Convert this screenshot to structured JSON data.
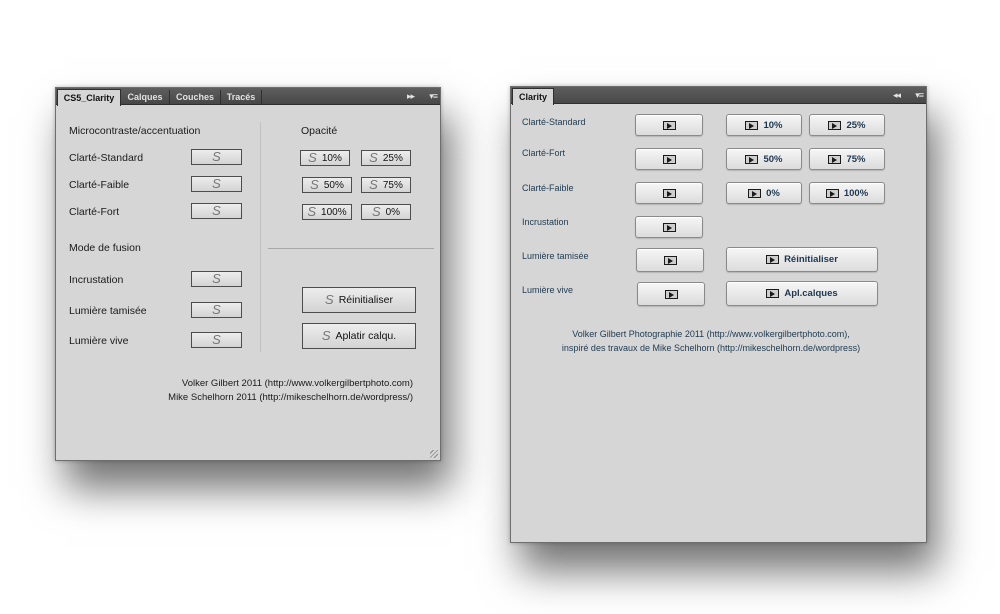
{
  "panel1": {
    "tabs": [
      "CS5_Clarity",
      "Calques",
      "Couches",
      "Tracés"
    ],
    "collapse_glyph": "▸▸",
    "menu_glyph": "▾≡",
    "section_micro": "Microcontraste/accentuation",
    "section_opacity": "Opacité",
    "rows_micro": [
      "Clarté-Standard",
      "Clarté-Faible",
      "Clarté-Fort"
    ],
    "section_fusion": "Mode de fusion",
    "rows_fusion": [
      "Incrustation",
      "Lumière tamisée",
      "Lumière vive"
    ],
    "opacity": [
      "10%",
      "25%",
      "50%",
      "75%",
      "100%",
      "0%"
    ],
    "reset": "Réinitialiser",
    "flatten": "Aplatir calqu.",
    "credit1": "Volker Gilbert 2011 (http://www.volkergilbertphoto.com)",
    "credit2": "Mike Schelhorn 2011 (http://mikeschelhorn.de/wordpress/)",
    "icon": "script-icon"
  },
  "panel2": {
    "tab": "Clarity",
    "collapse_glyph": "◂◂",
    "menu_glyph": "▾≡",
    "rows": [
      "Clarté-Standard",
      "Clarté-Fort",
      "Clarté-Faible",
      "Incrustation",
      "Lumière tamisée",
      "Lumière vive"
    ],
    "opacity": [
      "10%",
      "25%",
      "50%",
      "75%",
      "0%",
      "100%"
    ],
    "reset": "Réinitialiser",
    "flatten": "Apl.calques",
    "credit1": "Volker Gilbert Photographie  2011 (http://www.volkergilbertphoto.com),",
    "credit2": "inspiré des travaux de Mike Schelhorn (http://mikeschelhorn.de/wordpress)",
    "icon": "play-icon"
  }
}
